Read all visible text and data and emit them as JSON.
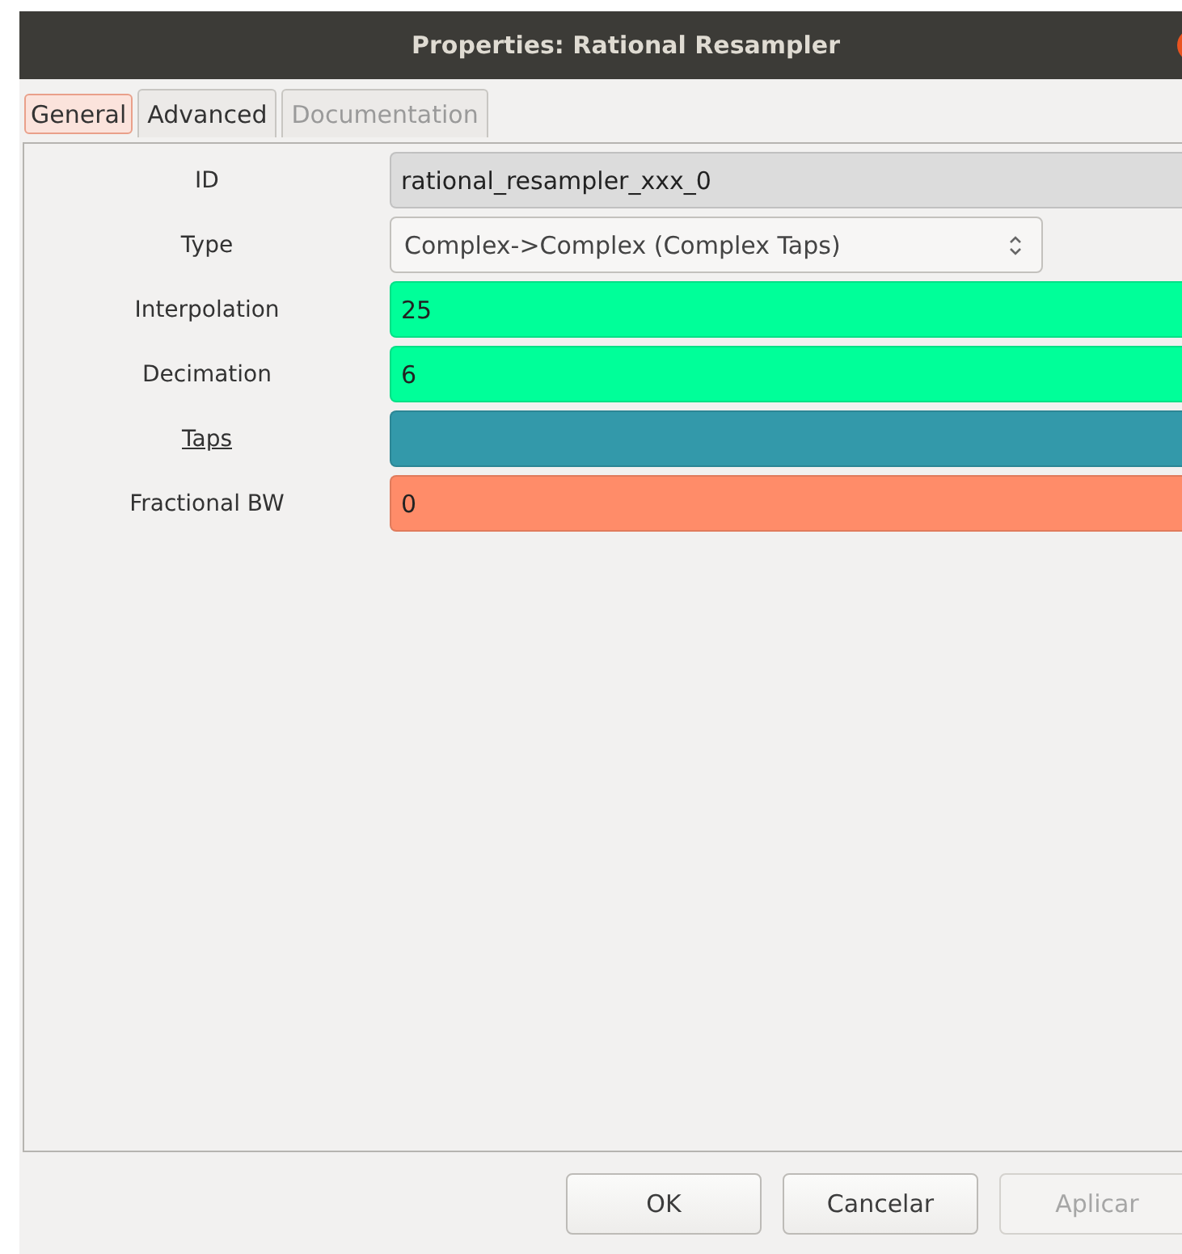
{
  "window": {
    "title": "Properties: Rational Resampler"
  },
  "tabs": [
    {
      "label": "General",
      "selected": true,
      "disabled": false
    },
    {
      "label": "Advanced",
      "selected": false,
      "disabled": false
    },
    {
      "label": "Documentation",
      "selected": false,
      "disabled": true
    }
  ],
  "fields": [
    {
      "label": "ID",
      "kind": "entry",
      "value": "rational_resampler_xxx_0",
      "color": "#dcdcdc",
      "underlined": false
    },
    {
      "label": "Type",
      "kind": "combo",
      "value": "Complex->Complex (Complex Taps)",
      "underlined": false
    },
    {
      "label": "Interpolation",
      "kind": "entry",
      "value": "25",
      "color": "#00ff99",
      "underlined": false
    },
    {
      "label": "Decimation",
      "kind": "entry",
      "value": "6",
      "color": "#00ff99",
      "underlined": false
    },
    {
      "label": "Taps",
      "kind": "entry",
      "color": "#3399aa",
      "underlined": true
    },
    {
      "label": "Fractional BW",
      "kind": "entry",
      "value": "0",
      "color": "#ff8c69",
      "underlined": false
    }
  ],
  "buttons": [
    {
      "label": "OK",
      "disabled": false
    },
    {
      "label": "Cancelar",
      "disabled": false
    },
    {
      "label": "Aplicar",
      "disabled": true
    }
  ]
}
